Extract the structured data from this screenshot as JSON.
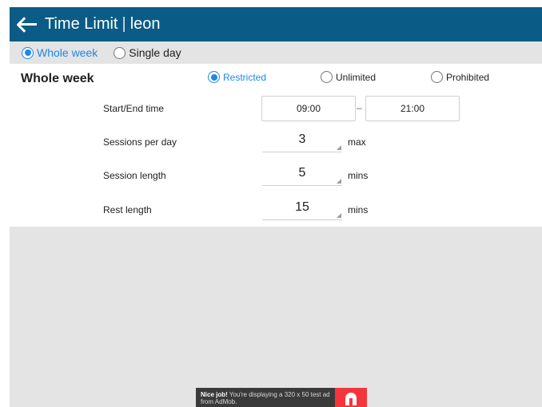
{
  "appbar": {
    "title": "Time Limit",
    "separator": "|",
    "user": "leon"
  },
  "mode_tabs": {
    "whole_week": "Whole week",
    "single_day": "Single day",
    "selected": "whole_week"
  },
  "section": {
    "title": "Whole week"
  },
  "policy": {
    "restricted": "Restricted",
    "unlimited": "Unlimited",
    "prohibited": "Prohibited",
    "selected": "restricted"
  },
  "rows": {
    "start_end": {
      "label": "Start/End time",
      "start": "09:00",
      "separator": "–",
      "end": "21:00"
    },
    "sessions": {
      "label": "Sessions per day",
      "value": "3",
      "unit": "max"
    },
    "session_length": {
      "label": "Session length",
      "value": "5",
      "unit": "mins"
    },
    "rest_length": {
      "label": "Rest length",
      "value": "15",
      "unit": "mins"
    }
  },
  "ad": {
    "bold": "Nice job!",
    "text": "You're displaying a 320 x 50 test ad from AdMob."
  },
  "colors": {
    "appbar": "#0a5c86",
    "accent": "#1e88e5",
    "ad_logo": "#f4363c"
  },
  "icons": {
    "back": "back-arrow-icon",
    "ad": "admob-logo-icon"
  }
}
